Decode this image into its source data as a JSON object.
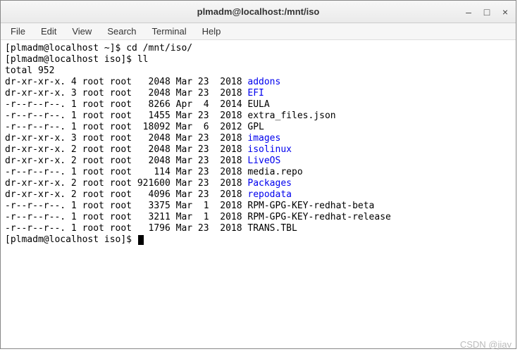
{
  "window": {
    "title": "plmadm@localhost:/mnt/iso",
    "controls": {
      "minimize": "–",
      "maximize": "□",
      "close": "×"
    }
  },
  "menubar": {
    "items": [
      "File",
      "Edit",
      "View",
      "Search",
      "Terminal",
      "Help"
    ]
  },
  "terminal": {
    "prompt1": "[plmadm@localhost ~]$ ",
    "cmd1": "cd /mnt/iso/",
    "prompt2": "[plmadm@localhost iso]$ ",
    "cmd2": "ll",
    "total_line": "total 952",
    "rows": [
      {
        "perm": "dr-xr-xr-x.",
        "links": "4",
        "owner": "root",
        "group": "root",
        "size": "2048",
        "month": "Mar",
        "day": "23",
        "year": "2018",
        "name": "addons",
        "dir": true
      },
      {
        "perm": "dr-xr-xr-x.",
        "links": "3",
        "owner": "root",
        "group": "root",
        "size": "2048",
        "month": "Mar",
        "day": "23",
        "year": "2018",
        "name": "EFI",
        "dir": true
      },
      {
        "perm": "-r--r--r--.",
        "links": "1",
        "owner": "root",
        "group": "root",
        "size": "8266",
        "month": "Apr",
        "day": "4",
        "year": "2014",
        "name": "EULA",
        "dir": false
      },
      {
        "perm": "-r--r--r--.",
        "links": "1",
        "owner": "root",
        "group": "root",
        "size": "1455",
        "month": "Mar",
        "day": "23",
        "year": "2018",
        "name": "extra_files.json",
        "dir": false
      },
      {
        "perm": "-r--r--r--.",
        "links": "1",
        "owner": "root",
        "group": "root",
        "size": "18092",
        "month": "Mar",
        "day": "6",
        "year": "2012",
        "name": "GPL",
        "dir": false
      },
      {
        "perm": "dr-xr-xr-x.",
        "links": "3",
        "owner": "root",
        "group": "root",
        "size": "2048",
        "month": "Mar",
        "day": "23",
        "year": "2018",
        "name": "images",
        "dir": true
      },
      {
        "perm": "dr-xr-xr-x.",
        "links": "2",
        "owner": "root",
        "group": "root",
        "size": "2048",
        "month": "Mar",
        "day": "23",
        "year": "2018",
        "name": "isolinux",
        "dir": true
      },
      {
        "perm": "dr-xr-xr-x.",
        "links": "2",
        "owner": "root",
        "group": "root",
        "size": "2048",
        "month": "Mar",
        "day": "23",
        "year": "2018",
        "name": "LiveOS",
        "dir": true
      },
      {
        "perm": "-r--r--r--.",
        "links": "1",
        "owner": "root",
        "group": "root",
        "size": "114",
        "month": "Mar",
        "day": "23",
        "year": "2018",
        "name": "media.repo",
        "dir": false
      },
      {
        "perm": "dr-xr-xr-x.",
        "links": "2",
        "owner": "root",
        "group": "root",
        "size": "921600",
        "month": "Mar",
        "day": "23",
        "year": "2018",
        "name": "Packages",
        "dir": true
      },
      {
        "perm": "dr-xr-xr-x.",
        "links": "2",
        "owner": "root",
        "group": "root",
        "size": "4096",
        "month": "Mar",
        "day": "23",
        "year": "2018",
        "name": "repodata",
        "dir": true
      },
      {
        "perm": "-r--r--r--.",
        "links": "1",
        "owner": "root",
        "group": "root",
        "size": "3375",
        "month": "Mar",
        "day": "1",
        "year": "2018",
        "name": "RPM-GPG-KEY-redhat-beta",
        "dir": false
      },
      {
        "perm": "-r--r--r--.",
        "links": "1",
        "owner": "root",
        "group": "root",
        "size": "3211",
        "month": "Mar",
        "day": "1",
        "year": "2018",
        "name": "RPM-GPG-KEY-redhat-release",
        "dir": false
      },
      {
        "perm": "-r--r--r--.",
        "links": "1",
        "owner": "root",
        "group": "root",
        "size": "1796",
        "month": "Mar",
        "day": "23",
        "year": "2018",
        "name": "TRANS.TBL",
        "dir": false
      }
    ],
    "prompt3": "[plmadm@localhost iso]$ "
  },
  "watermark": "CSDN @jiav"
}
